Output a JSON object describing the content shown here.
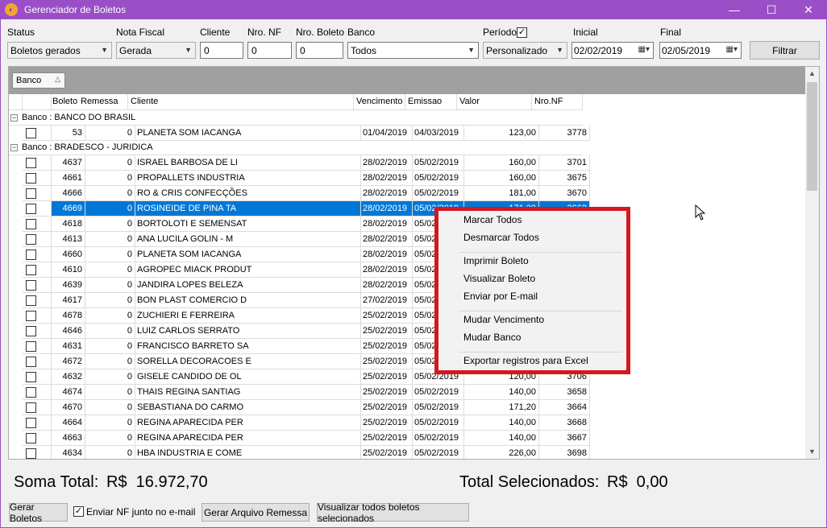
{
  "window": {
    "title": "Gerenciador de Boletos",
    "minimize": "—",
    "maximize": "☐",
    "close": "✕"
  },
  "filters": {
    "status": {
      "label": "Status",
      "value": "Boletos gerados"
    },
    "nota_fiscal": {
      "label": "Nota Fiscal",
      "value": "Gerada"
    },
    "cliente": {
      "label": "Cliente",
      "value": "0"
    },
    "nro_nf": {
      "label": "Nro. NF",
      "value": "0"
    },
    "nro_boleto": {
      "label": "Nro. Boleto",
      "value": "0"
    },
    "banco": {
      "label": "Banco",
      "value": "Todos"
    },
    "periodo": {
      "label": "Período",
      "checked": true,
      "value": "Personalizado"
    },
    "inicial": {
      "label": "Inicial",
      "value": "02/02/2019"
    },
    "final": {
      "label": "Final",
      "value": "02/05/2019"
    },
    "filter_button": "Filtrar"
  },
  "grid": {
    "group_chip": "Banco",
    "columns": [
      "Boleto",
      "Remessa",
      "Cliente",
      "Vencimento",
      "Emissao",
      "Valor",
      "Nro.NF"
    ],
    "groups": [
      {
        "label": "Banco : BANCO DO BRASIL",
        "rows": [
          {
            "boleto": "53",
            "remessa": "0",
            "cliente": "PLANETA SOM IACANGA",
            "vencimento": "01/04/2019",
            "emissao": "04/03/2019",
            "valor": "123,00",
            "nf": "3778"
          }
        ]
      },
      {
        "label": "Banco : BRADESCO - JURIDICA",
        "rows": [
          {
            "boleto": "4637",
            "remessa": "0",
            "cliente": "ISRAEL BARBOSA DE LI",
            "vencimento": "28/02/2019",
            "emissao": "05/02/2019",
            "valor": "160,00",
            "nf": "3701"
          },
          {
            "boleto": "4661",
            "remessa": "0",
            "cliente": "PROPALLETS INDUSTRIA",
            "vencimento": "28/02/2019",
            "emissao": "05/02/2019",
            "valor": "160,00",
            "nf": "3675"
          },
          {
            "boleto": "4666",
            "remessa": "0",
            "cliente": "RO & CRIS CONFECÇÕES",
            "vencimento": "28/02/2019",
            "emissao": "05/02/2019",
            "valor": "181,00",
            "nf": "3670"
          },
          {
            "boleto": "4669",
            "remessa": "0",
            "cliente": "ROSINEIDE DE PINA TA",
            "vencimento": "28/02/2019",
            "emissao": "05/02/2019",
            "valor": "171,20",
            "nf": "3662",
            "selected": true
          },
          {
            "boleto": "4618",
            "remessa": "0",
            "cliente": "BORTOLOTI E SEMENSAT",
            "vencimento": "28/02/2019",
            "emissao": "05/02/2019",
            "valor": "",
            "nf": ""
          },
          {
            "boleto": "4613",
            "remessa": "0",
            "cliente": "ANA LUCILA GOLIN - M",
            "vencimento": "28/02/2019",
            "emissao": "05/02/2019",
            "valor": "",
            "nf": ""
          },
          {
            "boleto": "4660",
            "remessa": "0",
            "cliente": "PLANETA SOM IACANGA",
            "vencimento": "28/02/2019",
            "emissao": "05/02/2019",
            "valor": "",
            "nf": ""
          },
          {
            "boleto": "4610",
            "remessa": "0",
            "cliente": "AGROPEC MIACK PRODUT",
            "vencimento": "28/02/2019",
            "emissao": "05/02/2019",
            "valor": "",
            "nf": ""
          },
          {
            "boleto": "4639",
            "remessa": "0",
            "cliente": "JANDIRA LOPES BELEZA",
            "vencimento": "28/02/2019",
            "emissao": "05/02/2019",
            "valor": "",
            "nf": ""
          },
          {
            "boleto": "4617",
            "remessa": "0",
            "cliente": "BON PLAST COMERCIO D",
            "vencimento": "27/02/2019",
            "emissao": "05/02/2019",
            "valor": "",
            "nf": ""
          },
          {
            "boleto": "4678",
            "remessa": "0",
            "cliente": "ZUCHIERI E FERREIRA",
            "vencimento": "25/02/2019",
            "emissao": "05/02/2019",
            "valor": "",
            "nf": ""
          },
          {
            "boleto": "4646",
            "remessa": "0",
            "cliente": "LUIZ CARLOS SERRATO",
            "vencimento": "25/02/2019",
            "emissao": "05/02/2019",
            "valor": "",
            "nf": ""
          },
          {
            "boleto": "4631",
            "remessa": "0",
            "cliente": "FRANCISCO BARRETO SA",
            "vencimento": "25/02/2019",
            "emissao": "05/02/2019",
            "valor": "",
            "nf": ""
          },
          {
            "boleto": "4672",
            "remessa": "0",
            "cliente": "SORELLA DECORACOES E",
            "vencimento": "25/02/2019",
            "emissao": "05/02/2019",
            "valor": "",
            "nf": ""
          },
          {
            "boleto": "4632",
            "remessa": "0",
            "cliente": "GISELE CANDIDO DE OL",
            "vencimento": "25/02/2019",
            "emissao": "05/02/2019",
            "valor": "120,00",
            "nf": "3706"
          },
          {
            "boleto": "4674",
            "remessa": "0",
            "cliente": "THAIS REGINA SANTIAG",
            "vencimento": "25/02/2019",
            "emissao": "05/02/2019",
            "valor": "140,00",
            "nf": "3658"
          },
          {
            "boleto": "4670",
            "remessa": "0",
            "cliente": "SEBASTIANA DO CARMO",
            "vencimento": "25/02/2019",
            "emissao": "05/02/2019",
            "valor": "171,20",
            "nf": "3664"
          },
          {
            "boleto": "4664",
            "remessa": "0",
            "cliente": "REGINA APARECIDA PER",
            "vencimento": "25/02/2019",
            "emissao": "05/02/2019",
            "valor": "140,00",
            "nf": "3668"
          },
          {
            "boleto": "4663",
            "remessa": "0",
            "cliente": "REGINA APARECIDA PER",
            "vencimento": "25/02/2019",
            "emissao": "05/02/2019",
            "valor": "140,00",
            "nf": "3667"
          },
          {
            "boleto": "4634",
            "remessa": "0",
            "cliente": "HBA INDUSTRIA E COME",
            "vencimento": "25/02/2019",
            "emissao": "05/02/2019",
            "valor": "226,00",
            "nf": "3698"
          }
        ]
      }
    ]
  },
  "context_menu": {
    "items": [
      {
        "label": "Marcar Todos"
      },
      {
        "label": "Desmarcar Todos"
      },
      {
        "separator": true
      },
      {
        "label": "Imprimir Boleto"
      },
      {
        "label": "Visualizar Boleto"
      },
      {
        "label": "Enviar por E-mail"
      },
      {
        "separator": true
      },
      {
        "label": "Mudar Vencimento"
      },
      {
        "label": "Mudar Banco"
      },
      {
        "separator": true
      },
      {
        "label": "Exportar registros para Excel"
      }
    ]
  },
  "totals": {
    "soma_label": "Soma Total:",
    "soma_value": "R$  16.972,70",
    "selecionados_label": "Total Selecionados:",
    "selecionados_value": "R$  0,00"
  },
  "footer": {
    "gerar_boletos": "Gerar Boletos",
    "enviar_nf_label": "Enviar NF junto no e-mail",
    "enviar_nf_checked": true,
    "gerar_remessa": "Gerar Arquivo Remessa",
    "visualizar_todos": "Visualizar todos boletos selecionados"
  },
  "colors": {
    "titlebar": "#9a4fc6",
    "selection": "#0078d7",
    "menu_highlight_border": "#d5171f"
  }
}
